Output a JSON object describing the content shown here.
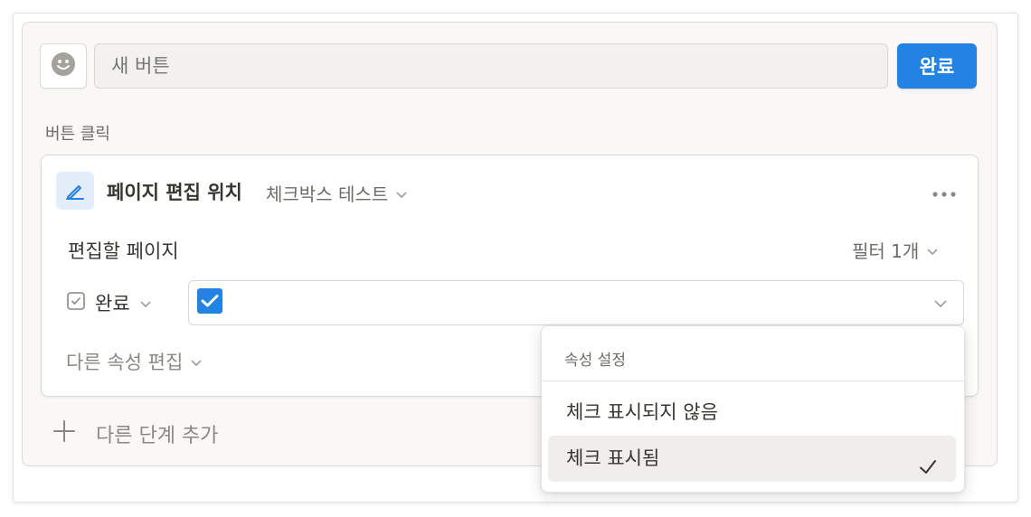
{
  "header": {
    "name_placeholder": "새 버튼",
    "done_label": "완료",
    "emoji_icon": "smiley-face-icon"
  },
  "section": {
    "label": "버튼 클릭"
  },
  "step": {
    "icon": "pencil-edit-icon",
    "title": "페이지 편집 위치",
    "database": "체크박스 테스트",
    "pages_label": "편집할 페이지",
    "filter_label": "필터 1개",
    "property_name": "완료",
    "property_checked": true,
    "edit_other_label": "다른 속성 편집"
  },
  "add_step_label": "다른 단계 추가",
  "dropdown": {
    "header": "속성 설정",
    "options": [
      {
        "label": "체크 표시되지 않음",
        "selected": false
      },
      {
        "label": "체크 표시됨",
        "selected": true
      }
    ]
  },
  "colors": {
    "accent": "#2383e2",
    "text": "#37352f",
    "muted": "#8a8883",
    "panel_bg": "#f9f8f6"
  }
}
